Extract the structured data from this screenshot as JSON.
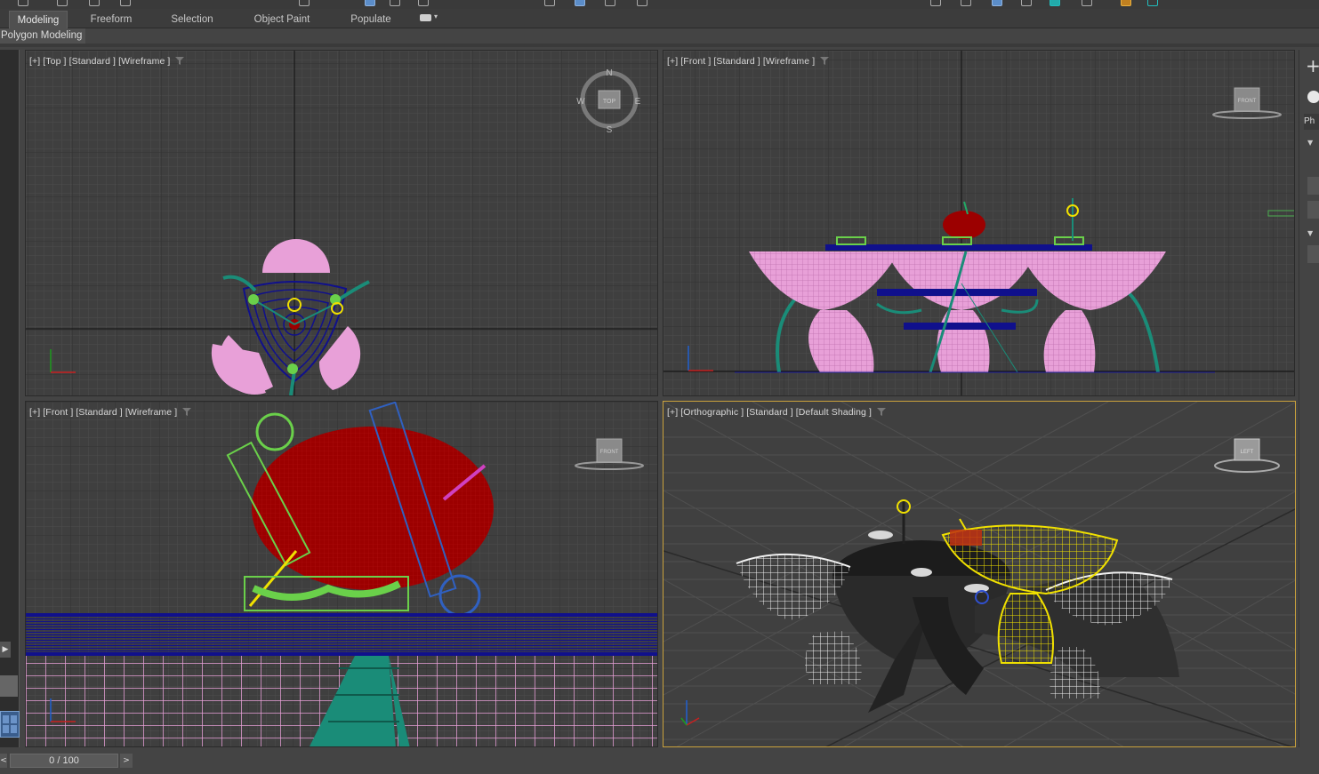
{
  "ribbon": {
    "tabs": [
      {
        "label": "Modeling",
        "active": true
      },
      {
        "label": "Freeform",
        "active": false
      },
      {
        "label": "Selection",
        "active": false
      },
      {
        "label": "Object Paint",
        "active": false
      },
      {
        "label": "Populate",
        "active": false
      }
    ],
    "subtitle": "Polygon Modeling"
  },
  "viewports": {
    "top": {
      "label": "[+] [Top ] [Standard ] [Wireframe ]",
      "compass": {
        "n": "N",
        "s": "S",
        "e": "E",
        "w": "W",
        "cube": "TOP"
      }
    },
    "front_a": {
      "label": "[+] [Front ] [Standard ] [Wireframe ]",
      "cube": "FRONT"
    },
    "front_b": {
      "label": "[+] [Front ] [Standard ] [Wireframe ]",
      "cube": "FRONT"
    },
    "ortho": {
      "label": "[+] [Orthographic ] [Standard ] [Default Shading ]",
      "cube": "LEFT",
      "active": true
    }
  },
  "right_panel": {
    "tab_label": "Ph"
  },
  "timeline": {
    "value": "0 / 100",
    "prev": "<",
    "next": ">"
  },
  "colors": {
    "viewport_bg": "#3e3e3e",
    "grid_minor": "#4a4a4a",
    "grid_major": "#2f2f2f",
    "active_border": "#c9a13c",
    "pink": "#e8a0d8",
    "navy": "#10108c",
    "teal": "#1a8c78",
    "red": "#9c0000",
    "yellow": "#f0e000"
  }
}
